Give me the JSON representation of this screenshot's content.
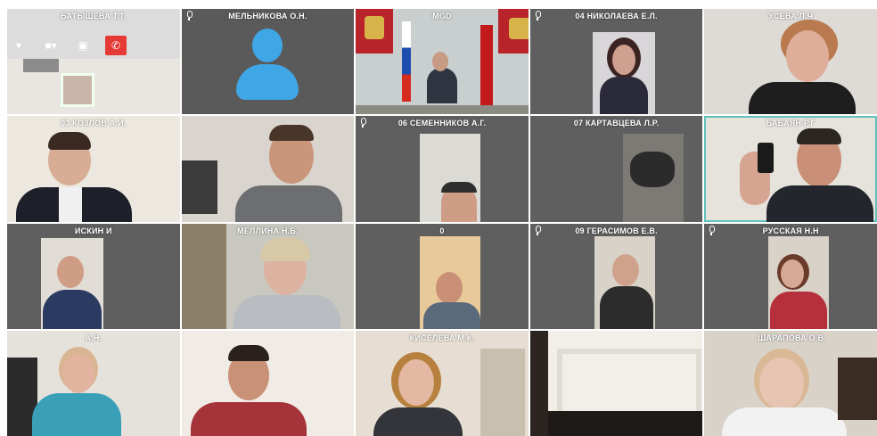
{
  "participants": [
    {
      "name": "БАТЫШЕВА Т.Т.",
      "mic": false
    },
    {
      "name": "МЕЛЬНИКОВА О.Н.",
      "mic": true
    },
    {
      "name": "MGD",
      "mic": false
    },
    {
      "name": "04 НИКОЛАЕВА Е.Л.",
      "mic": true
    },
    {
      "name": "УСЕВА Л.Ч",
      "mic": false
    },
    {
      "name": "03 КОЗЛОВ А.И.",
      "mic": false
    },
    {
      "name": "",
      "mic": false
    },
    {
      "name": "06 СЕМЕННИКОВ А.Г.",
      "mic": true
    },
    {
      "name": "07 КАРТАВЦЕВА Л.Р.",
      "mic": false
    },
    {
      "name": "БАБАЯН Р.Г",
      "mic": false
    },
    {
      "name": "ИСКИН И",
      "mic": false
    },
    {
      "name": "МЕЛЛИНА Н.Б.",
      "mic": false
    },
    {
      "name": "0",
      "mic": false
    },
    {
      "name": "09 ГЕРАСИМОВ Е.В.",
      "mic": true
    },
    {
      "name": "РУССКАЯ Н.Н",
      "mic": true
    },
    {
      "name": "А.Н.",
      "mic": false
    },
    {
      "name": "",
      "mic": false
    },
    {
      "name": "КИСЕЛЕВА М.К.",
      "mic": false
    },
    {
      "name": "",
      "mic": false
    },
    {
      "name": "ШАРАПОВА О.В",
      "mic": false
    }
  ],
  "toolbar": {
    "icons": [
      "chevron-down-icon",
      "camera-icon",
      "screen-share-icon",
      "hang-up-icon"
    ]
  },
  "colors": {
    "tile_bg": "#5f5f5f",
    "active_border": "#5fc2bb",
    "hangup": "#e53935",
    "avatar": "#3fa7e6"
  }
}
